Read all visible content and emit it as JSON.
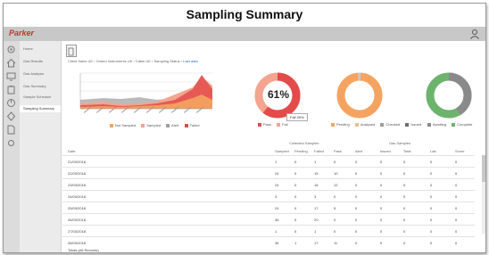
{
  "window": {
    "title": "Sampling Summary"
  },
  "brand": {
    "logo_text": "Parker",
    "accent": "#c0392b"
  },
  "sidebar": {
    "icons": [
      "gear-icon",
      "home-icon",
      "monitor-icon",
      "clipboard-icon",
      "chart-icon",
      "shield-icon",
      "document-icon",
      "settings-icon"
    ],
    "items": [
      {
        "label": "Home"
      },
      {
        "label": "Gas Results"
      },
      {
        "label": "Gas Analysis"
      },
      {
        "label": "Gas Summary"
      },
      {
        "label": "Sample Schedule"
      },
      {
        "label": "Sampling Summary",
        "active": true
      }
    ]
  },
  "breadcrumb": {
    "parts": [
      "Client Sales UK",
      "Oxford Instruments UK",
      "Cabin UK",
      "Sampling Status"
    ],
    "link": "Last data"
  },
  "area_chart": {
    "colors": {
      "red": "#e34b4b",
      "orange": "#f4a460",
      "grey": "#9e9e9e",
      "salmon": "#f3a58f"
    },
    "legend": [
      "Not Sampled",
      "Sampled",
      "Alert",
      "Failed"
    ]
  },
  "donuts": [
    {
      "name": "status",
      "label": "61%",
      "color": "#e34b4b",
      "legend": [
        "Pass",
        "Fail"
      ],
      "tooltip": "Fail 39%"
    },
    {
      "name": "quality",
      "color": "#f4a460",
      "legend": [
        "Pending",
        "Analysed",
        "Checked",
        "Issued"
      ]
    },
    {
      "name": "completion",
      "color": "#6db36d",
      "legend": [
        "Awaiting",
        "Complete"
      ]
    }
  ],
  "table": {
    "group_headers": [
      "Collected Samples",
      "Gas Samples"
    ],
    "columns": [
      "Date",
      "Sampled",
      "Pending",
      "Failed",
      "Pass",
      "Alert",
      "Issued",
      "Total",
      "Lab",
      "Score"
    ],
    "rows": [
      [
        "21/03/2018",
        "1",
        "0",
        "1",
        "0",
        "0",
        "0",
        "0",
        "0",
        "0"
      ],
      [
        "22/03/2018",
        "24",
        "0",
        "15",
        "10",
        "0",
        "0",
        "0",
        "0",
        "0"
      ],
      [
        "23/03/2018",
        "24",
        "0",
        "18",
        "12",
        "0",
        "0",
        "0",
        "0",
        "0"
      ],
      [
        "24/03/2018",
        "3",
        "0",
        "3",
        "0",
        "0",
        "0",
        "0",
        "0",
        "0"
      ],
      [
        "25/03/2018",
        "24",
        "0",
        "17",
        "5",
        "0",
        "0",
        "0",
        "0",
        "0"
      ],
      [
        "26/03/2018",
        "36",
        "0",
        "20",
        "0",
        "0",
        "0",
        "0",
        "0",
        "0"
      ],
      [
        "27/03/2018",
        "1",
        "0",
        "1",
        "0",
        "0",
        "0",
        "0",
        "0",
        "0"
      ],
      [
        "28/03/2018",
        "36",
        "1",
        "17",
        "11",
        "0",
        "0",
        "0",
        "0",
        "0"
      ]
    ],
    "totals_label": "Totals (All Records)"
  }
}
